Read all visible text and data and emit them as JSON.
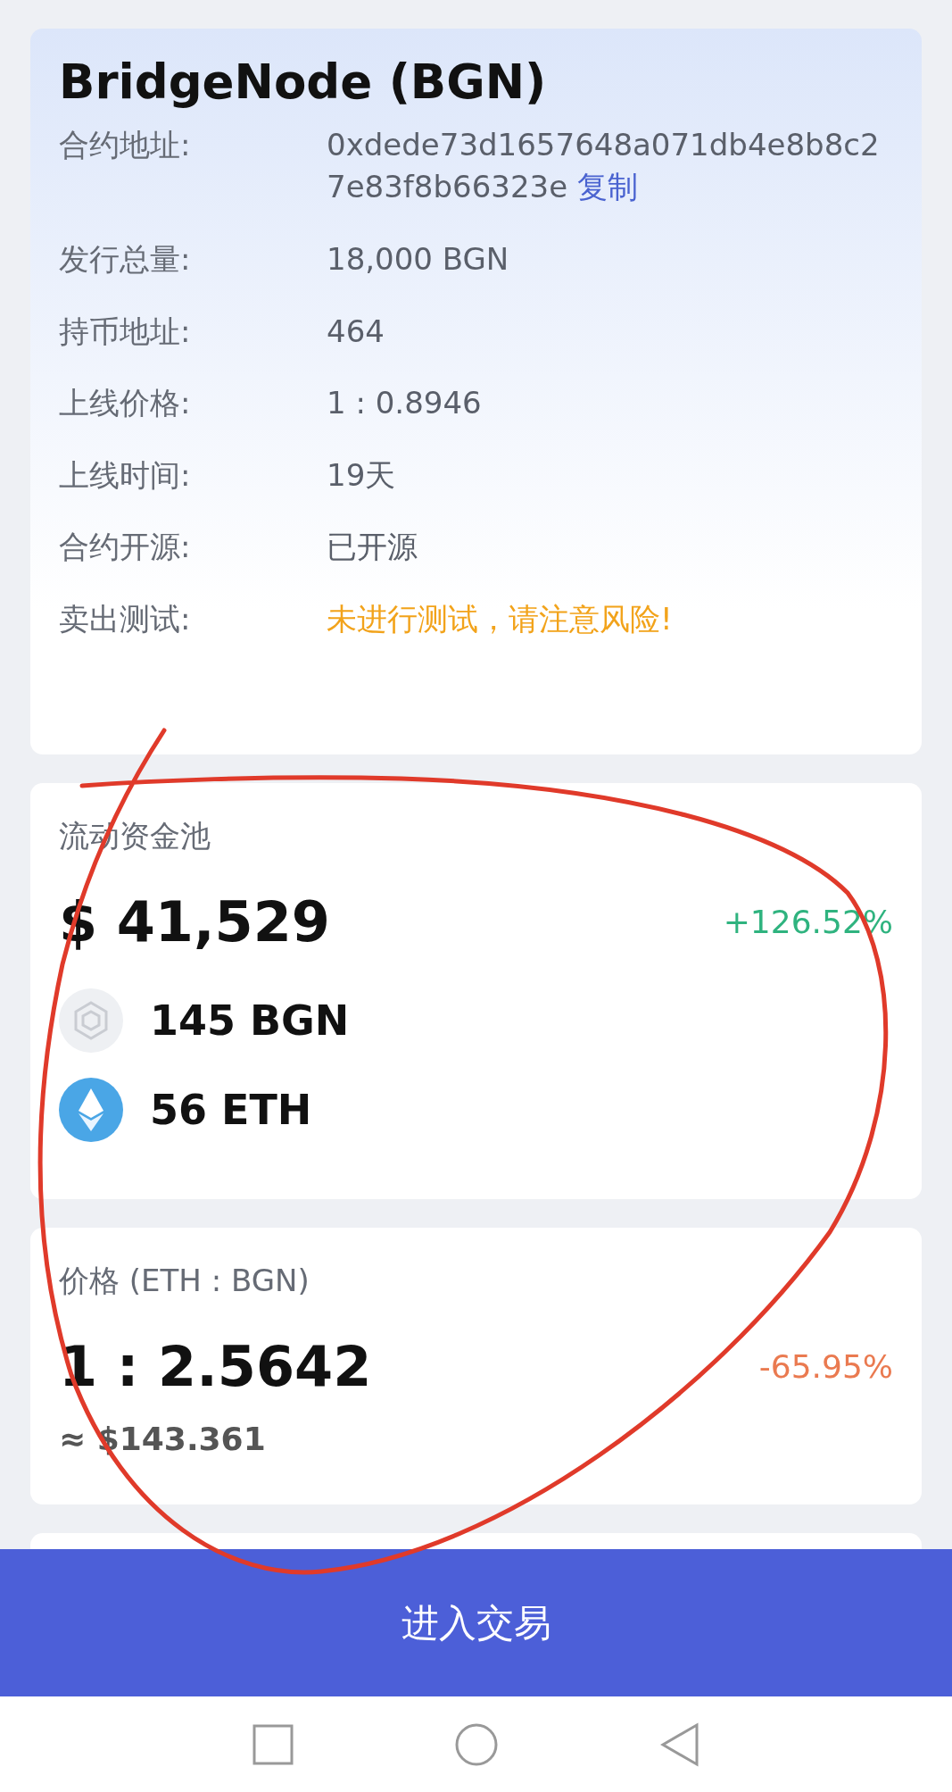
{
  "token": {
    "title": "BridgeNode (BGN)",
    "details": [
      {
        "label": "合约地址:",
        "value": "0xdede73d1657648a071db4e8b8c27e83f8b66323e",
        "link": "复制",
        "kind": "address"
      },
      {
        "label": "发行总量:",
        "value": "18,000 BGN",
        "kind": "plain"
      },
      {
        "label": "持币地址:",
        "value": "464",
        "kind": "plain"
      },
      {
        "label": "上线价格:",
        "value": "1 : 0.8946",
        "kind": "plain"
      },
      {
        "label": "上线时间:",
        "value": "19天",
        "kind": "plain"
      },
      {
        "label": "合约开源:",
        "value": "已开源",
        "kind": "plain"
      },
      {
        "label": "卖出测试:",
        "value": "未进行测试，请注意风险!",
        "kind": "warning"
      }
    ]
  },
  "pool": {
    "title": "流动资金池",
    "total": "$ 41,529",
    "change": "+126.52%",
    "rising": true,
    "assets": [
      {
        "amount": "145 BGN",
        "kind": "bgn"
      },
      {
        "amount": "56 ETH",
        "kind": "eth"
      }
    ]
  },
  "price": {
    "title": "价格 (ETH : BGN)",
    "ratio": "1 : 2.5642",
    "usd": "≈ $143.361",
    "change": "-65.95%",
    "rising": false
  },
  "action": {
    "label": "进入交易"
  }
}
